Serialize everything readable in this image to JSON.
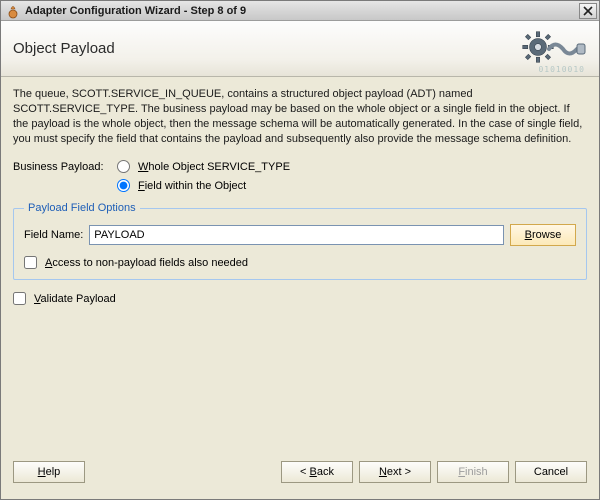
{
  "window": {
    "title": "Adapter Configuration Wizard - Step 8 of 9"
  },
  "header": {
    "page_title": "Object Payload"
  },
  "description": "The queue, SCOTT.SERVICE_IN_QUEUE, contains a structured object payload (ADT) named SCOTT.SERVICE_TYPE. The business payload may be based on the whole object or a single field in the object. If the payload is the whole object, then the message schema will be automatically generated. In the case of single field, you must specify the field that contains the payload and subsequently also provide the message schema definition.",
  "business_payload": {
    "label": "Business Payload:",
    "option_whole_prefix": "W",
    "option_whole_rest": "hole Object SERVICE_TYPE",
    "option_field_prefix": "F",
    "option_field_rest": "ield within the Object",
    "selected": "field"
  },
  "payload_field_options": {
    "legend": "Payload Field Options",
    "field_name_label": "Field Name:",
    "field_name_value": "PAYLOAD",
    "browse_prefix": "B",
    "browse_rest": "rowse",
    "access_prefix": "A",
    "access_rest": "ccess to non-payload fields also needed",
    "access_checked": false
  },
  "validate": {
    "prefix": "V",
    "rest": "alidate Payload",
    "checked": false
  },
  "footer": {
    "help_prefix": "H",
    "help_rest": "elp",
    "back_prefix": "< ",
    "back_u": "B",
    "back_rest": "ack",
    "next_prefix": "N",
    "next_rest": "ext >",
    "finish_prefix": "F",
    "finish_rest": "inish",
    "cancel": "Cancel"
  }
}
